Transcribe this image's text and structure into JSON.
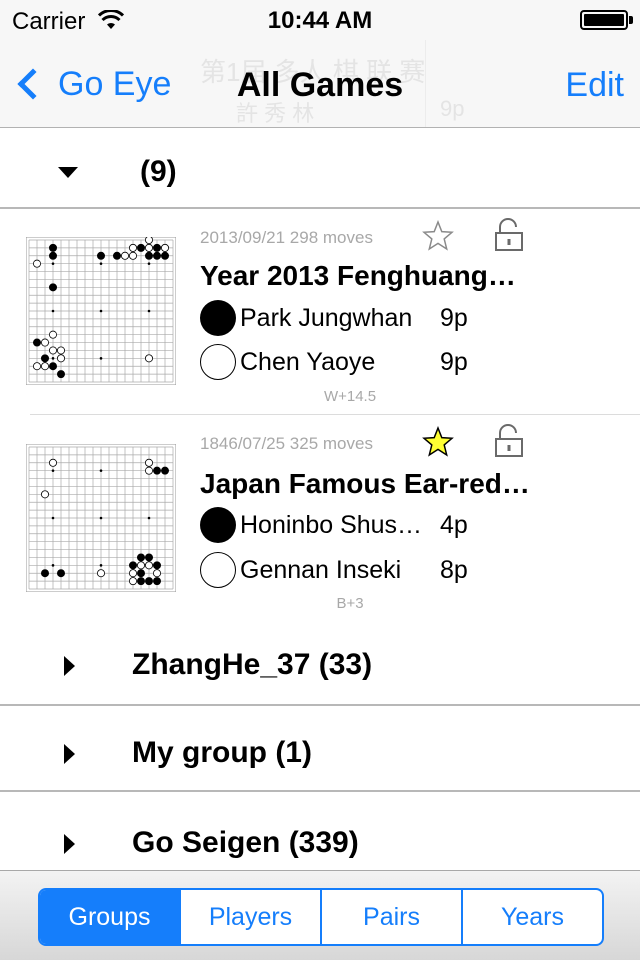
{
  "status_bar": {
    "carrier": "Carrier",
    "time": "10:44 AM"
  },
  "nav": {
    "back_label": "Go Eye",
    "title": "All Games",
    "edit_label": "Edit",
    "ghost_title": "第1届 多人 棋 联 赛",
    "ghost_player": "許 秀 林",
    "ghost_rank": "9p"
  },
  "groups": [
    {
      "label": "(9)",
      "expanded": true
    },
    {
      "label": "ZhangHe_37 (33)",
      "expanded": false
    },
    {
      "label": "My group (1)",
      "expanded": false
    },
    {
      "label": "Go Seigen (339)",
      "expanded": false
    }
  ],
  "games": [
    {
      "meta": "2013/09/21 298 moves",
      "starred": false,
      "title": "Year 2013 Fenghuang…",
      "black": {
        "name": "Park Jungwhan",
        "rank": "9p"
      },
      "white": {
        "name": "Chen Yaoye",
        "rank": "9p"
      },
      "result": "W+14.5",
      "stones": [
        [
          15,
          0,
          "w"
        ],
        [
          14,
          1,
          "b"
        ],
        [
          15,
          1,
          "w"
        ],
        [
          16,
          1,
          "b"
        ],
        [
          17,
          1,
          "w"
        ],
        [
          13,
          1,
          "w"
        ],
        [
          9,
          2,
          "b"
        ],
        [
          11,
          2,
          "b"
        ],
        [
          15,
          2,
          "b"
        ],
        [
          16,
          2,
          "b"
        ],
        [
          17,
          2,
          "b"
        ],
        [
          13,
          2,
          "w"
        ],
        [
          12,
          2,
          "w"
        ],
        [
          3,
          1,
          "b"
        ],
        [
          3,
          2,
          "b"
        ],
        [
          1,
          3,
          "w"
        ],
        [
          3,
          6,
          "b"
        ],
        [
          3,
          12,
          "w"
        ],
        [
          1,
          13,
          "b"
        ],
        [
          2,
          13,
          "w"
        ],
        [
          3,
          14,
          "w"
        ],
        [
          4,
          14,
          "w"
        ],
        [
          2,
          15,
          "b"
        ],
        [
          4,
          15,
          "w"
        ],
        [
          1,
          16,
          "w"
        ],
        [
          2,
          16,
          "w"
        ],
        [
          4,
          17,
          "b"
        ],
        [
          3,
          16,
          "b"
        ],
        [
          15,
          15,
          "w"
        ]
      ]
    },
    {
      "meta": "1846/07/25 325 moves",
      "starred": true,
      "title": "Japan Famous Ear-red…",
      "black": {
        "name": "Honinbo Shus…",
        "rank": "4p"
      },
      "white": {
        "name": "Gennan Inseki",
        "rank": "8p"
      },
      "result": "B+3",
      "stones": [
        [
          3,
          2,
          "w"
        ],
        [
          15,
          2,
          "w"
        ],
        [
          16,
          3,
          "b"
        ],
        [
          17,
          3,
          "b"
        ],
        [
          15,
          3,
          "w"
        ],
        [
          2,
          6,
          "w"
        ],
        [
          14,
          14,
          "b"
        ],
        [
          15,
          14,
          "b"
        ],
        [
          13,
          15,
          "b"
        ],
        [
          15,
          15,
          "w"
        ],
        [
          16,
          15,
          "b"
        ],
        [
          13,
          16,
          "w"
        ],
        [
          14,
          16,
          "b"
        ],
        [
          16,
          16,
          "w"
        ],
        [
          13,
          17,
          "w"
        ],
        [
          14,
          17,
          "b"
        ],
        [
          15,
          17,
          "b"
        ],
        [
          16,
          17,
          "b"
        ],
        [
          2,
          16,
          "b"
        ],
        [
          4,
          16,
          "b"
        ],
        [
          9,
          16,
          "w"
        ],
        [
          14,
          15,
          "w"
        ]
      ]
    }
  ],
  "tabs": [
    {
      "label": "Groups",
      "active": true
    },
    {
      "label": "Players",
      "active": false
    },
    {
      "label": "Pairs",
      "active": false
    },
    {
      "label": "Years",
      "active": false
    }
  ],
  "colors": {
    "accent": "#157efb",
    "star_fill": "#ffff33",
    "separator": "#b8b8b8"
  },
  "icons": {
    "back": "chevron-left-icon",
    "expanded": "triangle-down-icon",
    "collapsed": "triangle-right-icon",
    "star": "star-icon",
    "lock": "unlocked-padlock-icon",
    "wifi": "wifi-icon",
    "battery": "battery-icon"
  }
}
